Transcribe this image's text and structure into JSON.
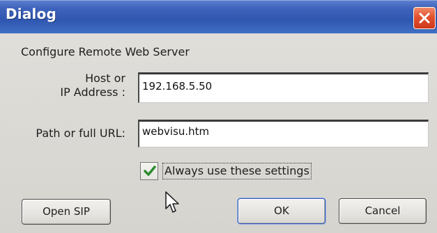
{
  "window": {
    "title": "Dialog",
    "close_icon": "close-icon"
  },
  "form": {
    "heading": "Configure Remote Web Server",
    "host_label_line1": "Host or",
    "host_label_line2": "IP Address :",
    "host_value": "192.168.5.50",
    "path_label": "Path or full URL:",
    "path_value": "webvisu.htm",
    "always_use_label": "Always use these settings",
    "always_use_checked": true
  },
  "buttons": {
    "open_sip": "Open SIP",
    "ok": "OK",
    "cancel": "Cancel"
  },
  "colors": {
    "titlebar": "#2f56b0",
    "close_button": "#e2512e",
    "checkmark": "#2e8b2e"
  }
}
